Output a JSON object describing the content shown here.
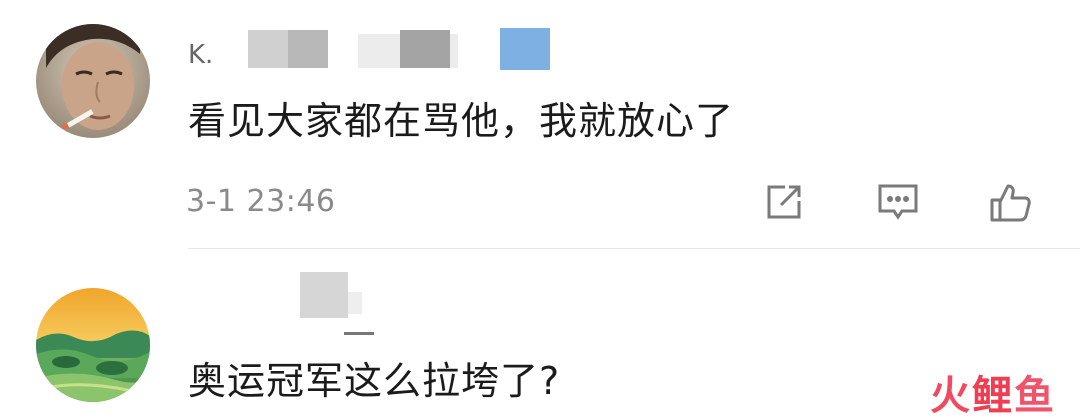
{
  "comments": [
    {
      "text": "看见大家都在骂他，我就放心了",
      "time": "3-1 23:46",
      "name_partial": "K."
    },
    {
      "text": "奥运冠军这么拉垮了?"
    }
  ],
  "actions": {
    "share_icon": "share-icon",
    "reply_icon": "comment-icon",
    "like_icon": "thumbs-up-icon"
  },
  "watermark": {
    "chars": [
      "火",
      "鲤",
      "鱼"
    ]
  },
  "colors": {
    "text": "#1b1b1b",
    "meta": "#8a8a8a",
    "icon": "#7a7a7a",
    "blur_gray": "#9a9a9a",
    "blur_blue": "#7fb0e3",
    "watermark": "#ef3d52"
  }
}
